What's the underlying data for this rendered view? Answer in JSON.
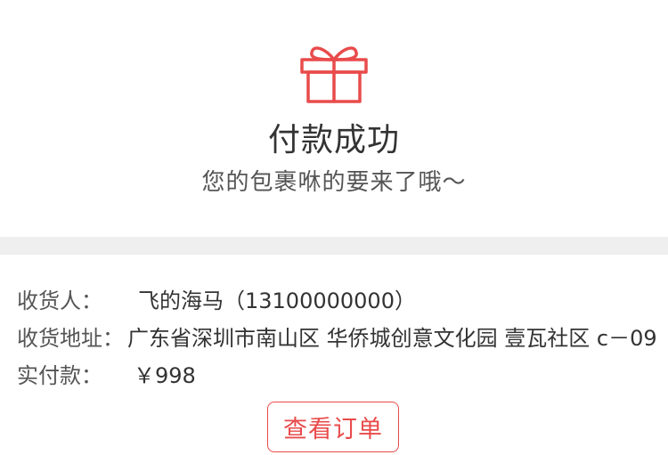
{
  "colors": {
    "accent": "#e94b4b",
    "divider": "#efefef",
    "text": "#333333"
  },
  "hero": {
    "icon": "gift-icon",
    "title": "付款成功",
    "subtitle": "您的包裹咻的要来了哦～"
  },
  "order_info": {
    "receiver_label": "收货人：",
    "receiver_value": "飞的海马（13100000000）",
    "address_label": "收货地址：",
    "address_value": "广东省深圳市南山区 华侨城创意文化园 壹瓦社区 c－09",
    "payment_label": "实付款：",
    "payment_value": "￥998"
  },
  "actions": {
    "view_order_label": "查看订单"
  }
}
